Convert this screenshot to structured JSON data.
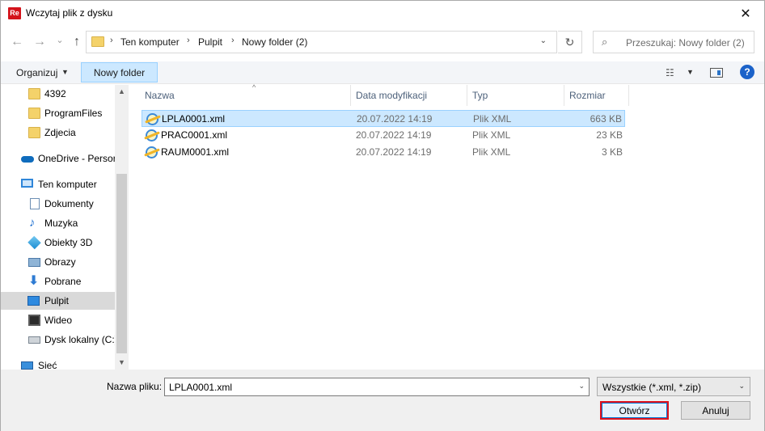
{
  "window": {
    "app_icon_text": "Re",
    "title": "Wczytaj plik z dysku",
    "close_glyph": "✕"
  },
  "address": {
    "back_glyph": "←",
    "forward_glyph": "→",
    "recent_glyph": "⌄",
    "up_glyph": "↑",
    "crumbs": [
      "Ten komputer",
      "Pulpit",
      "Nowy folder (2)"
    ],
    "sep_glyph": "›",
    "dropdown_glyph": "⌄",
    "refresh_glyph": "↻"
  },
  "search": {
    "icon_glyph": "⌕",
    "placeholder": "Przeszukaj: Nowy folder (2)"
  },
  "toolbar": {
    "organize_label": "Organizuj",
    "organize_arrow": "▼",
    "new_folder_label": "Nowy folder",
    "view_glyph": "☷",
    "view_arrow": "▼",
    "help_glyph": "?"
  },
  "nav": {
    "items": [
      {
        "label": "4392",
        "icon": "folder-icon"
      },
      {
        "label": "ProgramFiles",
        "icon": "folder-icon"
      },
      {
        "label": "Zdjecia",
        "icon": "folder-icon"
      },
      {
        "label": "OneDrive - Persor",
        "icon": "onedrive-icon"
      },
      {
        "label": "Ten komputer",
        "icon": "computer-icon"
      },
      {
        "label": "Dokumenty",
        "icon": "documents-icon"
      },
      {
        "label": "Muzyka",
        "icon": "music-icon"
      },
      {
        "label": "Obiekty 3D",
        "icon": "objects-3d-icon"
      },
      {
        "label": "Obrazy",
        "icon": "pictures-icon"
      },
      {
        "label": "Pobrane",
        "icon": "downloads-icon"
      },
      {
        "label": "Pulpit",
        "icon": "desktop-icon"
      },
      {
        "label": "Wideo",
        "icon": "video-icon"
      },
      {
        "label": "Dysk lokalny (C:)",
        "icon": "local-disk-icon"
      },
      {
        "label": "Sieć",
        "icon": "network-icon"
      }
    ],
    "music_glyph": "♪",
    "download_glyph": "⬇",
    "scroll_up_glyph": "▲",
    "scroll_down_glyph": "▼"
  },
  "files": {
    "columns": {
      "name": "Nazwa",
      "date": "Data modyfikacji",
      "type": "Typ",
      "size": "Rozmiar"
    },
    "sort_glyph": "^",
    "rows": [
      {
        "name": "LPLA0001.xml",
        "date": "20.07.2022 14:19",
        "type": "Plik XML",
        "size": "663 KB"
      },
      {
        "name": "PRAC0001.xml",
        "date": "20.07.2022 14:19",
        "type": "Plik XML",
        "size": "23 KB"
      },
      {
        "name": "RAUM0001.xml",
        "date": "20.07.2022 14:19",
        "type": "Plik XML",
        "size": "3 KB"
      }
    ]
  },
  "bottom": {
    "filename_label": "Nazwa pliku:",
    "filename_value": "LPLA0001.xml",
    "filename_drop": "⌄",
    "filter_value": "Wszystkie (*.xml, *.zip)",
    "filter_drop": "⌄",
    "open_label": "Otwórz",
    "cancel_label": "Anuluj"
  }
}
